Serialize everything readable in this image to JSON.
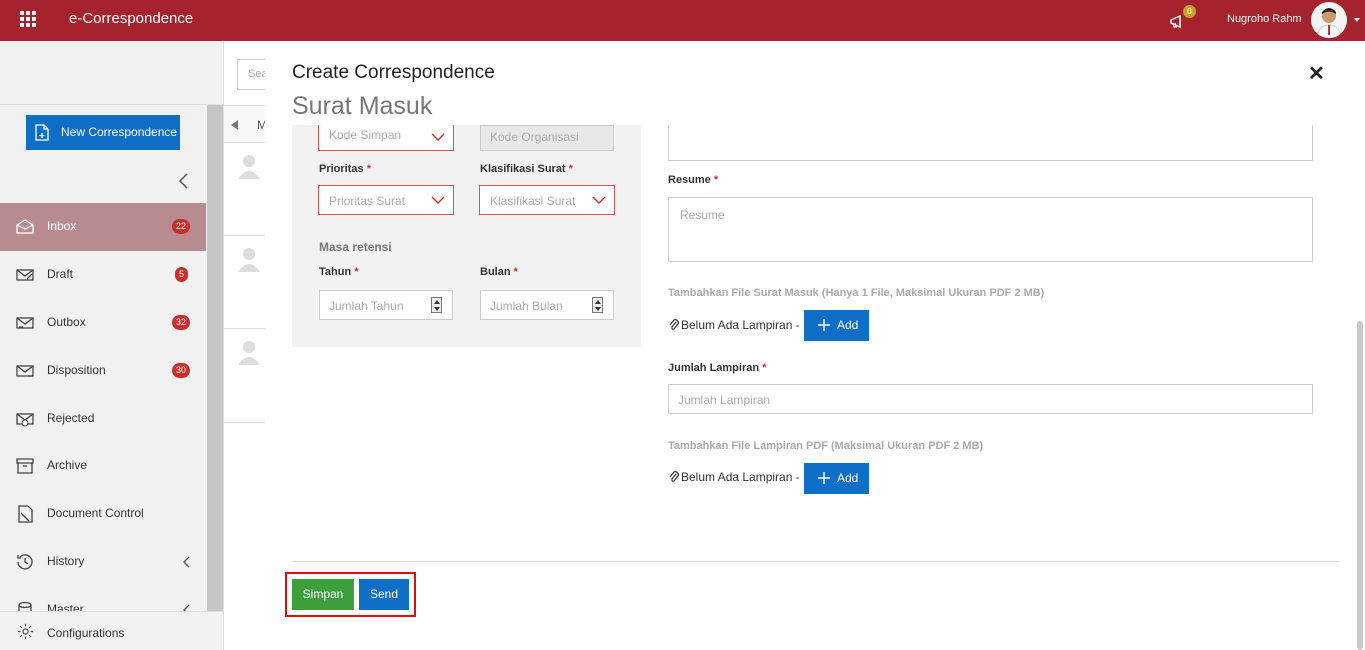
{
  "header": {
    "app_title": "e-Correspondence",
    "notification_count": "0",
    "user_name": "Nugroho Rahm"
  },
  "sidebar": {
    "new_button_label": "New Correspondence",
    "items": [
      {
        "label": "Inbox",
        "badge": "22",
        "icon": "inbox-icon"
      },
      {
        "label": "Draft",
        "badge": "5",
        "icon": "draft-icon"
      },
      {
        "label": "Outbox",
        "badge": "32",
        "icon": "outbox-icon"
      },
      {
        "label": "Disposition",
        "badge": "30",
        "icon": "disposition-icon"
      },
      {
        "label": "Rejected",
        "badge": "",
        "icon": "rejected-icon"
      },
      {
        "label": "Archive",
        "badge": "",
        "icon": "archive-icon"
      },
      {
        "label": "Document Control",
        "badge": "",
        "icon": "document-control-icon"
      },
      {
        "label": "History",
        "badge": "",
        "icon": "history-icon"
      },
      {
        "label": "Master",
        "badge": "",
        "icon": "master-icon"
      }
    ],
    "config_label": "Configurations"
  },
  "list": {
    "search_placeholder": "Sea",
    "head_label": "M"
  },
  "modal": {
    "title": "Create Correspondence",
    "subtitle": "Surat Masuk",
    "left": {
      "kode_simpan_placeholder": "Kode Simpan",
      "kode_organisasi_placeholder": "Kode Organisasi",
      "prioritas_label": "Prioritas",
      "prioritas_placeholder": "Prioritas Surat",
      "klasifikasi_label": "Klasifikasi Surat",
      "klasifikasi_placeholder": "Klasifikasi Surat",
      "masa_retensi_label": "Masa retensi",
      "tahun_label": "Tahun",
      "tahun_placeholder": "Jumlah Tahun",
      "bulan_label": "Bulan",
      "bulan_placeholder": "Jumlah Bulan"
    },
    "right": {
      "resume_label": "Resume",
      "resume_placeholder": "Resume",
      "file_surat_hint": "Tambahkan File Surat Masuk (Hanya 1 File, Maksimal Ukuran PDF 2 MB)",
      "no_attachment_text": "Belum Ada Lampiran -",
      "add_label": "Add",
      "jumlah_lampiran_label": "Jumlah Lampiran",
      "jumlah_lampiran_placeholder": "Jumlah Lampiran",
      "file_lampiran_hint": "Tambahkan File Lampiran PDF (Maksimal Ukuran PDF 2 MB)",
      "no_attachment_text_2": "Belum Ada Lampiran -",
      "add_label_2": "Add"
    },
    "required_mark": "*",
    "footer": {
      "save_label": "Simpan",
      "send_label": "Send"
    }
  },
  "colors": {
    "brand": "#a5232d",
    "primary": "#0f6fc6",
    "success": "#3c9f3c",
    "danger": "#c9302c"
  }
}
